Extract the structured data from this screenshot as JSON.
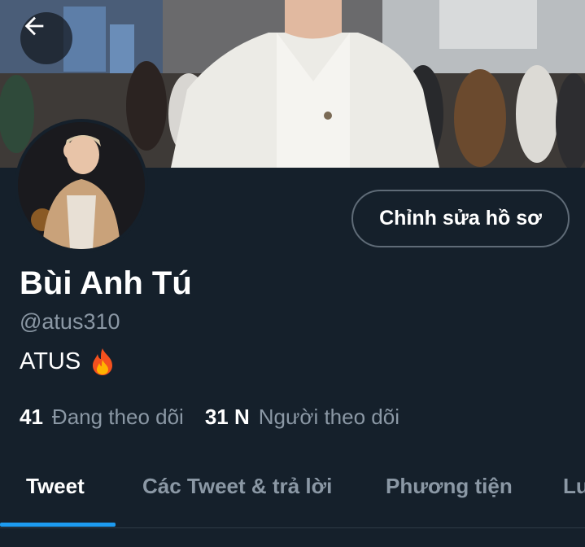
{
  "header": {
    "back_icon": "arrow-left-icon"
  },
  "profile": {
    "edit_button_label": "Chỉnh sửa hồ sơ",
    "display_name": "Bùi Anh Tú",
    "handle": "@atus310",
    "bio_text": "ATUS",
    "bio_emoji_icon": "fire-icon",
    "following_count": "41",
    "following_label": "Đang theo dõi",
    "followers_count": "31 N",
    "followers_label": "Người theo dõi"
  },
  "tabs": [
    {
      "label": "Tweet",
      "active": true
    },
    {
      "label": "Các Tweet & trả lời",
      "active": false
    },
    {
      "label": "Phương tiện",
      "active": false
    },
    {
      "label": "Lư",
      "active": false
    }
  ],
  "colors": {
    "background": "#15202b",
    "secondary_text": "#8b98a5",
    "accent": "#1d9bf0"
  }
}
